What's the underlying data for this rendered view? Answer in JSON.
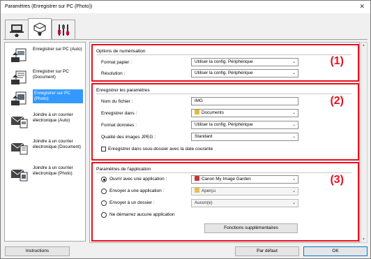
{
  "window": {
    "title": "Paramètres (Enregistrer sur PC (Photo))",
    "close_glyph": "✕"
  },
  "tabs": [
    {
      "name": "scan-from-computer-icon"
    },
    {
      "name": "scan-from-panel-icon"
    },
    {
      "name": "general-settings-icon"
    }
  ],
  "sidebar": {
    "items": [
      {
        "label": "Enregistrer sur PC (Auto)"
      },
      {
        "label": "Enregistrer sur PC (Document)"
      },
      {
        "label": "Enregistrer sur PC (Photo)"
      },
      {
        "label": "Joindre à un courrier électronique (Auto)"
      },
      {
        "label": "Joindre à un courrier électronique (Document)"
      },
      {
        "label": "Joindre à un courrier électronique (Photo)"
      }
    ]
  },
  "section1": {
    "number": "(1)",
    "title": "Options de numérisation",
    "paper_label": "Format papier :",
    "paper_value": "Utiliser la config. Périphérique",
    "resolution_label": "Résolution :",
    "resolution_value": "Utiliser la config. Périphérique"
  },
  "section2": {
    "number": "(2)",
    "title": "Enregistrer les paramètres",
    "filename_label": "Nom du fichier :",
    "filename_value": "IMG",
    "savein_label": "Enregistrer dans :",
    "savein_value": "Documents",
    "format_label": "Format données :",
    "format_value": "Utiliser la config. Périphérique",
    "jpeg_label": "Qualité des images JPEG :",
    "jpeg_value": "Standard",
    "subfolder_label": "Enregistrer dans sous-dossier avec la date courante"
  },
  "section3": {
    "number": "(3)",
    "title": "Paramètres de l'application",
    "open_label": "Ouvrir avec une application :",
    "open_value": "Canon My Image Garden",
    "send_app_label": "Envoyer à une application :",
    "send_app_value": "Aperçu",
    "send_folder_label": "Envoyer à un dossier :",
    "send_folder_value": "Aucun(e)",
    "none_label": "Ne démarrez aucune application",
    "more_functions": "Fonctions supplémentaires"
  },
  "footer": {
    "instructions": "Instructions",
    "defaults": "Par défaut",
    "ok": "OK"
  },
  "colors": {
    "highlight": "#e8101e",
    "selection": "#3399ff"
  }
}
